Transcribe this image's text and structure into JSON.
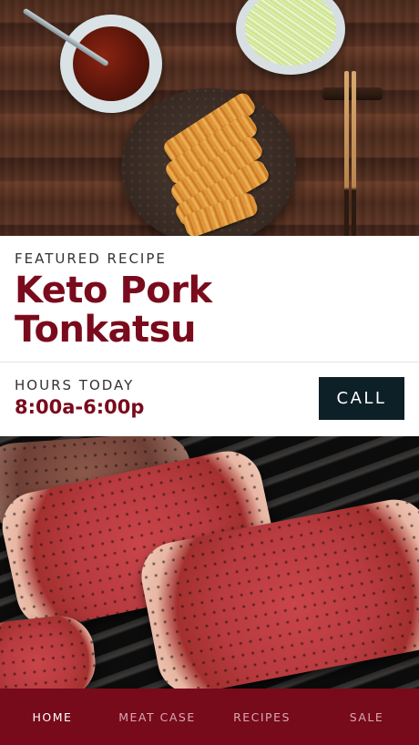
{
  "featured": {
    "eyebrow": "FEATURED RECIPE",
    "title": "Keto Pork Tonkatsu"
  },
  "hours": {
    "label": "HOURS TODAY",
    "value": "8:00a-6:00p",
    "call_label": "CALL"
  },
  "nav": {
    "active": "HOME",
    "items": [
      "HOME",
      "MEAT CASE",
      "RECIPES",
      "SALE"
    ]
  },
  "colors": {
    "brand": "#7a0b1c",
    "nav_background": "#770a1b",
    "call_button": "#0d1f27"
  }
}
